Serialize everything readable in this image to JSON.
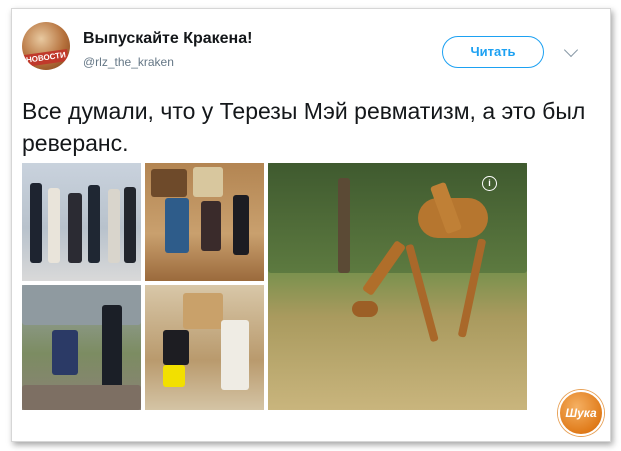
{
  "tweet": {
    "author_name": "Выпускайте Кракена!",
    "author_handle": "@rlz_the_kraken",
    "avatar_label": "НОВОСТИ",
    "follow_label": "Читать",
    "text": "Все думали, что у Терезы Мэй ревматизм, а это был реверанс."
  },
  "media": {
    "info_icon_glyph": "i",
    "photos": [
      "royal-greeting-group",
      "curtsey-in-room",
      "curtsey-outdoor",
      "curtsey-to-queen",
      "giraffe-drinking"
    ]
  },
  "watermark": {
    "text": "Шука"
  },
  "colors": {
    "accent": "#1da1f2",
    "text": "#14171a",
    "muted": "#657786"
  }
}
